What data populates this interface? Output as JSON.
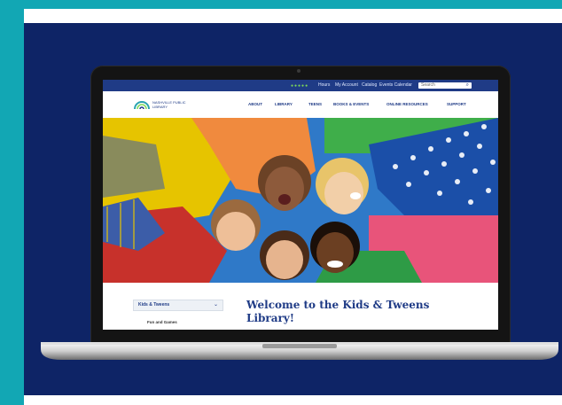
{
  "utility_bar": {
    "links": [
      "Hours",
      "My Account",
      "Catalog",
      "Events Calendar"
    ],
    "search_placeholder": "Search"
  },
  "logo": {
    "text": "NASHVILLE PUBLIC LIBRARY"
  },
  "main_nav": {
    "items": [
      "ABOUT",
      "LIBRARY",
      "TEENS",
      "BOOKS & EVENTS",
      "ONLINE RESOURCES",
      "SUPPORT"
    ]
  },
  "sidebar": {
    "select_label": "Kids & Tweens",
    "submenu_item": "Fun and Games"
  },
  "welcome": {
    "heading": "Welcome to the Kids & Tweens Library!"
  },
  "colors": {
    "teal": "#12a7b4",
    "navy": "#0e2466",
    "site_blue": "#1f3b86"
  }
}
